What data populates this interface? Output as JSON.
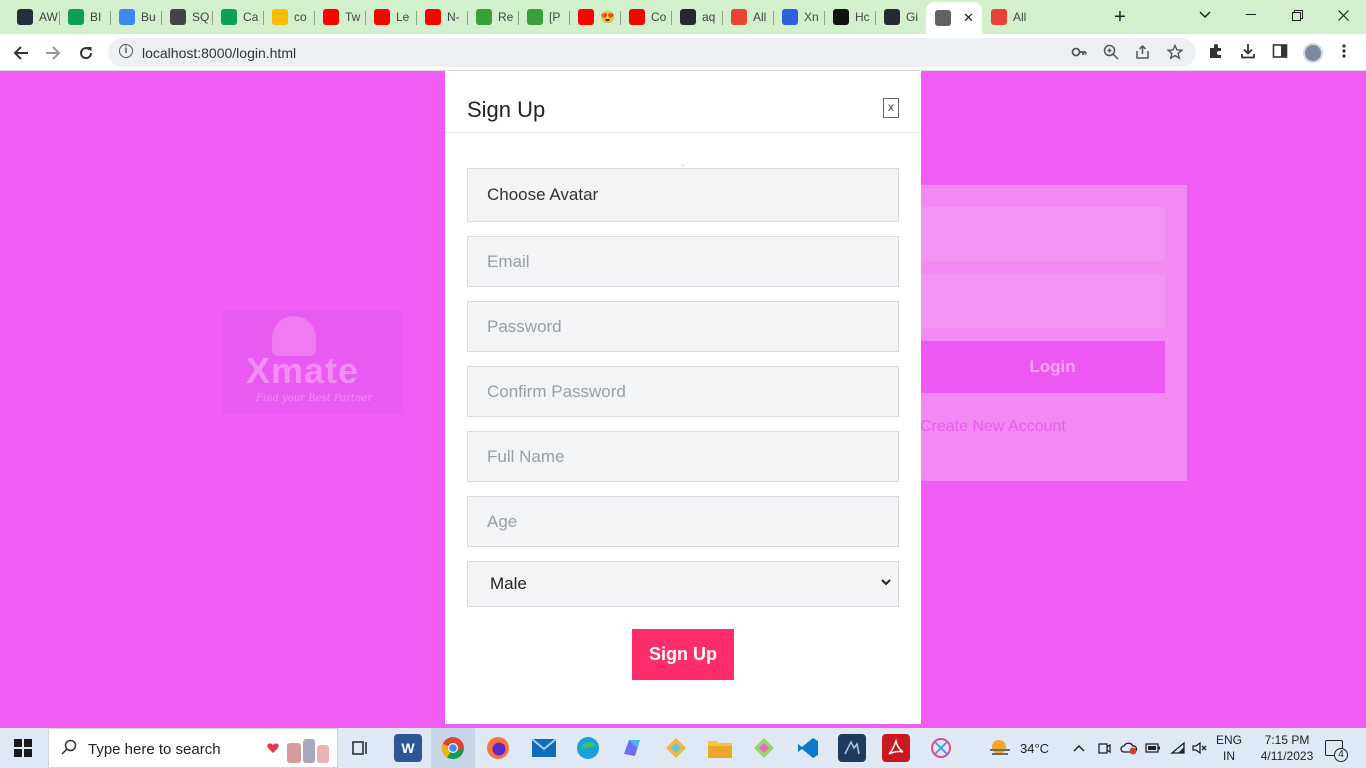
{
  "browser": {
    "tabs": [
      {
        "label": "AW",
        "icon": "aws-icon",
        "color": "#232f3e"
      },
      {
        "label": "BI",
        "icon": "sheets-icon",
        "color": "#0f9d58"
      },
      {
        "label": "Bu",
        "icon": "cloud-icon",
        "color": "#4285f4"
      },
      {
        "label": "SQ",
        "icon": "doc-icon",
        "color": "#444444"
      },
      {
        "label": "Ca",
        "icon": "sheets-icon",
        "color": "#0f9d58"
      },
      {
        "label": "co",
        "icon": "drive-icon",
        "color": "#fbbc04"
      },
      {
        "label": "Tw",
        "icon": "youtube-icon",
        "color": "#ff0000"
      },
      {
        "label": "Le",
        "icon": "youtube-icon",
        "color": "#ff0000"
      },
      {
        "label": "N-",
        "icon": "youtube-icon",
        "color": "#ff0000"
      },
      {
        "label": "Re",
        "icon": "leaf-icon",
        "color": "#3a9e3a"
      },
      {
        "label": "[P",
        "icon": "leaf-icon",
        "color": "#3a9e3a"
      },
      {
        "label": "😍",
        "icon": "youtube-icon",
        "color": "#ff0000"
      },
      {
        "label": "Co",
        "icon": "youtube-icon",
        "color": "#ff0000"
      },
      {
        "label": "aq",
        "icon": "github-icon",
        "color": "#24292f"
      },
      {
        "label": "All",
        "icon": "gmail-icon",
        "color": "#ea4335"
      },
      {
        "label": "Xn",
        "icon": "bookmark-icon",
        "color": "#2d5fe0"
      },
      {
        "label": "Hc",
        "icon": "hackerrank-icon",
        "color": "#111111"
      },
      {
        "label": "Gi",
        "icon": "github-icon",
        "color": "#24292f"
      },
      {
        "label": "",
        "icon": "globe-icon",
        "color": "#5f6368",
        "active": true
      },
      {
        "label": "All",
        "icon": "gmail-icon",
        "color": "#ea4335"
      }
    ],
    "url": "localhost:8000/login.html"
  },
  "page": {
    "background": "#f05cf4",
    "logo": {
      "word": "Xmate",
      "tagline": "Find your Best Partner"
    },
    "login": {
      "button": "Login",
      "link": "Create New Account"
    }
  },
  "modal": {
    "title": "Sign Up",
    "close": "x",
    "fields": {
      "avatar": "Choose Avatar",
      "email": "Email",
      "password": "Password",
      "confirm": "Confirm Password",
      "fullname": "Full Name",
      "age": "Age"
    },
    "gender": "Male",
    "submit": "Sign Up",
    "accent": "#ff2d6b"
  },
  "taskbar": {
    "search_placeholder": "Type here to search",
    "weather": "34°C",
    "lang1": "ENG",
    "lang2": "IN",
    "time": "7:15 PM",
    "date": "4/11/2023",
    "notifications": "4"
  }
}
